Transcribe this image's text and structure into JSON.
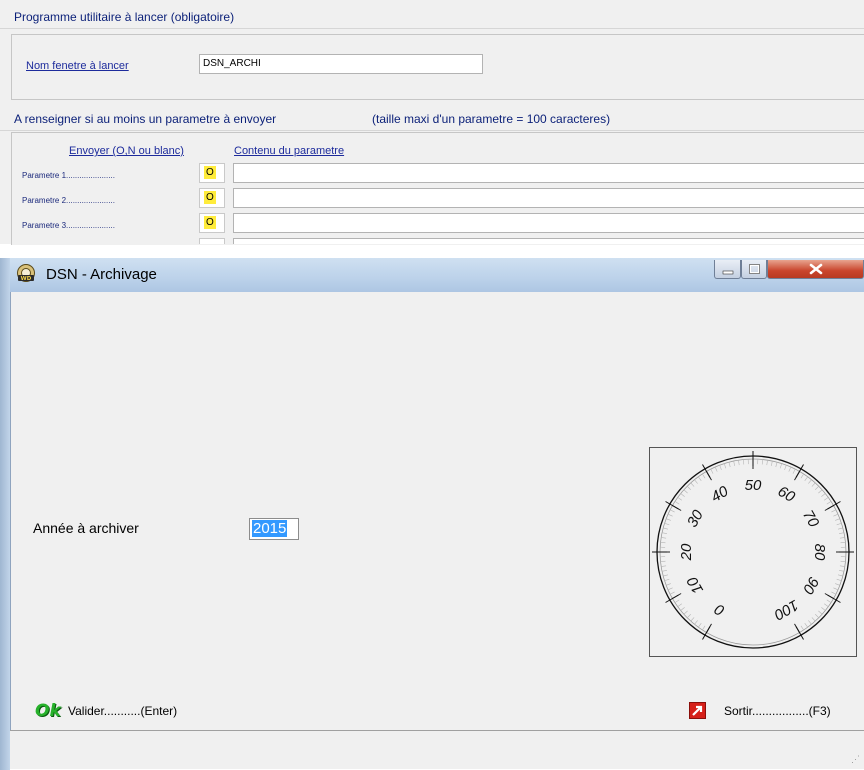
{
  "config": {
    "section1_title": "Programme utilitaire à lancer  (obligatoire)",
    "window_name_label": "Nom fenetre à lancer",
    "window_name_value": "DSN_ARCHI",
    "section2_title": "A renseigner si au moins un parametre à envoyer",
    "section2_note": "(taille maxi d'un parametre = 100 caracteres)",
    "col_send": "Envoyer (O,N ou blanc)",
    "col_content": "Contenu du parametre",
    "params": [
      {
        "label": "Parametre 1......................",
        "send": "O",
        "content": ""
      },
      {
        "label": "Parametre 2......................",
        "send": "O",
        "content": ""
      },
      {
        "label": "Parametre 3......................",
        "send": "O",
        "content": ""
      }
    ]
  },
  "window": {
    "title": "DSN - Archivage",
    "year_label": "Année à archiver",
    "year_value": "2015",
    "gauge": {
      "ticks": [
        "0",
        "10",
        "20",
        "30",
        "40",
        "50",
        "60",
        "70",
        "80",
        "90",
        "100"
      ]
    },
    "ok_label": "Ok",
    "validate_label": "Valider...........(Enter)",
    "exit_label": "Sortir.................(F3)"
  }
}
